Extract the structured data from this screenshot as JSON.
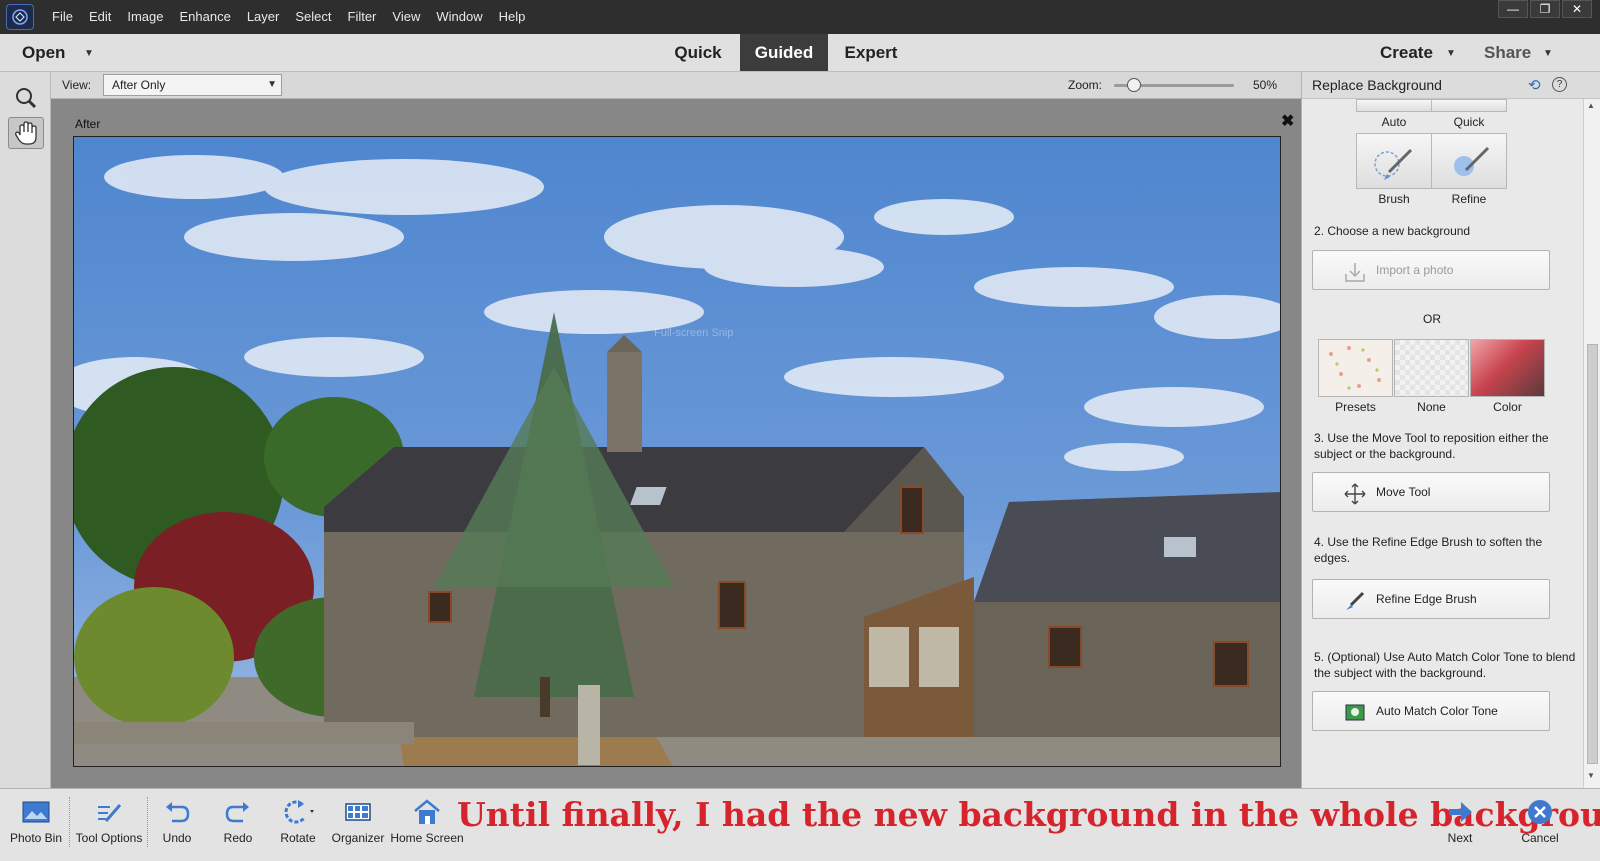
{
  "menubar": {
    "logo_icon": "photoshop-elements-logo-icon",
    "items": [
      "File",
      "Edit",
      "Image",
      "Enhance",
      "Layer",
      "Select",
      "Filter",
      "View",
      "Window",
      "Help"
    ],
    "window_controls": [
      "minimize-icon",
      "restore-icon",
      "close-icon"
    ]
  },
  "modebar": {
    "open_label": "Open",
    "tabs": [
      "Quick",
      "Guided",
      "Expert"
    ],
    "active_tab": "Guided",
    "create_label": "Create",
    "share_label": "Share"
  },
  "toolbar": {
    "tools": [
      "zoom-tool-icon",
      "hand-tool-icon"
    ],
    "selected": "hand-tool-icon"
  },
  "options": {
    "view_label": "View:",
    "view_value": "After Only",
    "zoom_label": "Zoom:",
    "zoom_value": "50%",
    "zoom_fraction": 0.17
  },
  "canvas": {
    "doc_label": "After",
    "close_symbol": "✖",
    "watermark": "Full-screen Snip"
  },
  "panel": {
    "title": "Replace Background",
    "selection_tools": [
      {
        "label": "Auto",
        "icon": "auto-select-icon"
      },
      {
        "label": "Quick",
        "icon": "quick-select-icon"
      },
      {
        "label": "Brush",
        "icon": "selection-brush-icon"
      },
      {
        "label": "Refine",
        "icon": "refine-selection-icon"
      }
    ],
    "step2": "2. Choose a new background",
    "import_label": "Import a photo",
    "or_label": "OR",
    "backgrounds": [
      {
        "label": "Presets",
        "icon": "presets-swatch-icon"
      },
      {
        "label": "None",
        "icon": "transparent-swatch-icon"
      },
      {
        "label": "Color",
        "icon": "color-swatch-icon"
      }
    ],
    "step3": "3. Use the Move Tool to reposition either the subject or the background.",
    "move_label": "Move Tool",
    "step4": "4. Use the Refine Edge Brush to soften the edges.",
    "refine_label": "Refine Edge Brush",
    "step5": "5. (Optional) Use Auto Match Color Tone to blend the subject with the background.",
    "match_label": "Auto Match Color Tone"
  },
  "bottombar": {
    "items": [
      "Photo Bin",
      "Tool Options",
      "Undo",
      "Redo",
      "Rotate",
      "Organizer",
      "Home Screen"
    ],
    "next_label": "Next",
    "cancel_label": "Cancel"
  },
  "caption": "Until finally, I had the new background in the whole background."
}
